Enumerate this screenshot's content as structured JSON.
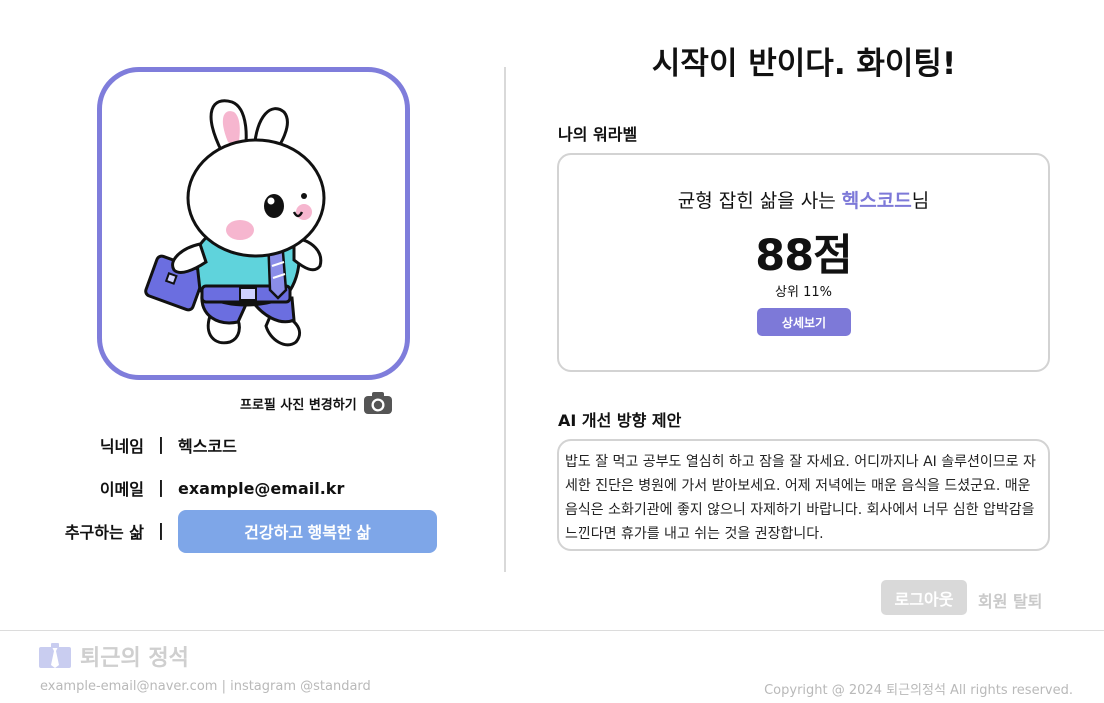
{
  "profile": {
    "change_photo_label": "프로필 사진 변경하기",
    "fields": [
      {
        "label": "닉네임",
        "separator": "|",
        "value": "헥스코드"
      },
      {
        "label": "이메일",
        "separator": "|",
        "value": "example@email.kr"
      },
      {
        "label": "추구하는 삶",
        "separator": "|",
        "value": "건강하고 행복한 삶"
      }
    ],
    "colors": {
      "frame": "#7f7ddb",
      "life_button": "#7ea6e8"
    }
  },
  "main": {
    "headline": "시작이 반이다. 화이팅!",
    "wlb_section_title": "나의 워라벨",
    "wlb_card": {
      "prefix": "균형 잡힌 삶을 사는 ",
      "nickname": "헥스코드",
      "suffix": "님",
      "score": "88점",
      "rank": "상위 11%",
      "detail_button": "상세보기"
    },
    "ai_section_title": "AI 개선 방향 제안",
    "ai_text": "밥도 잘 먹고 공부도 열심히 하고 잠을 잘 자세요. 어디까지나 AI 솔루션이므로 자세한 진단은 병원에 가서 받아보세요. 어제 저녁에는 매운 음식을 드셨군요. 매운 음식은 소화기관에 좋지 않으니 자제하기 바랍니다. 회사에서 너무 심한 압박감을 느낀다면 휴가를 내고 쉬는 것을 권장합니다.",
    "logout_label": "로그아웃",
    "withdraw_label": "회원 탈퇴",
    "colors": {
      "accent": "#7d79d8",
      "disabled": "#d9d9d9"
    }
  },
  "footer": {
    "brand": "퇴근의 정석",
    "contact": "example-email@naver.com | instagram @standard",
    "copyright": "Copyright @ 2024 퇴근의정석 All rights reserved."
  },
  "icons": [
    "bunny-mascot-illustration",
    "camera-icon",
    "necktie-logo-icon"
  ]
}
